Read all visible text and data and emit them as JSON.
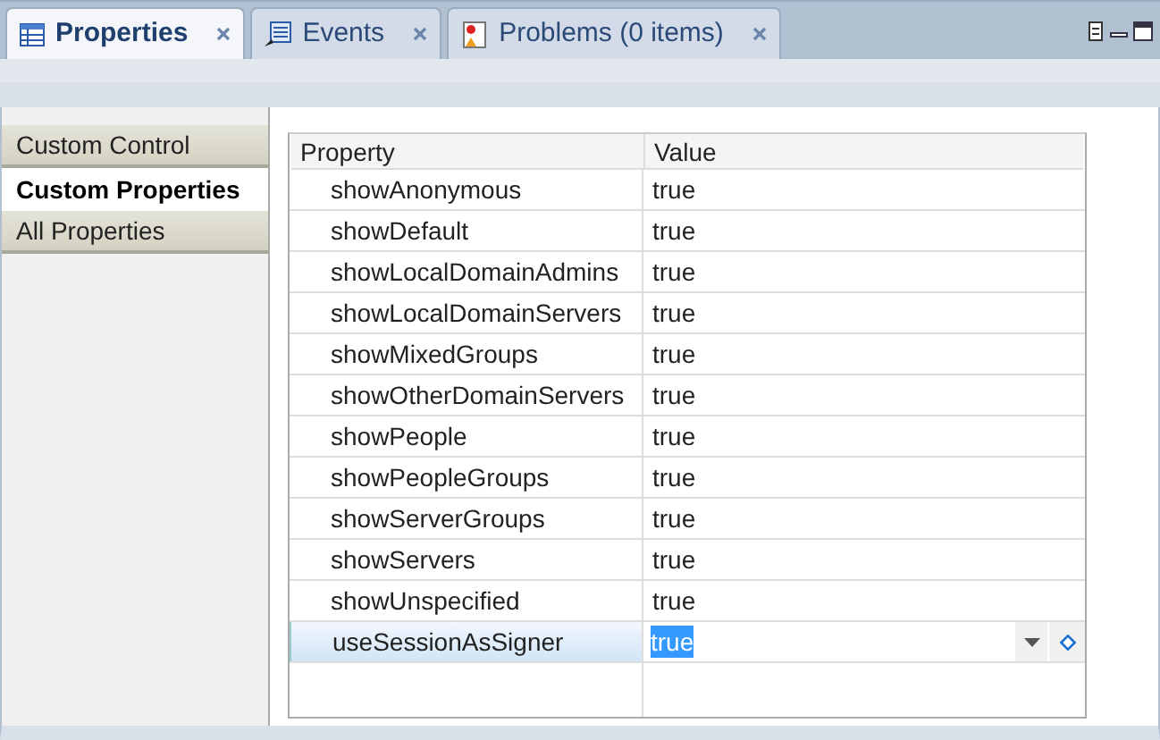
{
  "tabs": [
    {
      "label": "Properties",
      "kind": "table",
      "selected": true
    },
    {
      "label": "Events",
      "kind": "events",
      "selected": false
    },
    {
      "label": "Problems (0 items)",
      "kind": "problems",
      "selected": false
    }
  ],
  "sidebar": {
    "items": [
      {
        "label": "Custom Control",
        "selected": false
      },
      {
        "label": "Custom Properties",
        "selected": true
      },
      {
        "label": "All Properties",
        "selected": false
      }
    ]
  },
  "table": {
    "columns": [
      "Property",
      "Value"
    ],
    "rows": [
      {
        "property": "showAnonymous",
        "value": "true",
        "selected": false
      },
      {
        "property": "showDefault",
        "value": "true",
        "selected": false
      },
      {
        "property": "showLocalDomainAdmins",
        "value": "true",
        "selected": false
      },
      {
        "property": "showLocalDomainServers",
        "value": "true",
        "selected": false
      },
      {
        "property": "showMixedGroups",
        "value": "true",
        "selected": false
      },
      {
        "property": "showOtherDomainServers",
        "value": "true",
        "selected": false
      },
      {
        "property": "showPeople",
        "value": "true",
        "selected": false
      },
      {
        "property": "showPeopleGroups",
        "value": "true",
        "selected": false
      },
      {
        "property": "showServerGroups",
        "value": "true",
        "selected": false
      },
      {
        "property": "showServers",
        "value": "true",
        "selected": false
      },
      {
        "property": "showUnspecified",
        "value": "true",
        "selected": false
      },
      {
        "property": "useSessionAsSigner",
        "value": "true",
        "selected": true
      }
    ]
  }
}
